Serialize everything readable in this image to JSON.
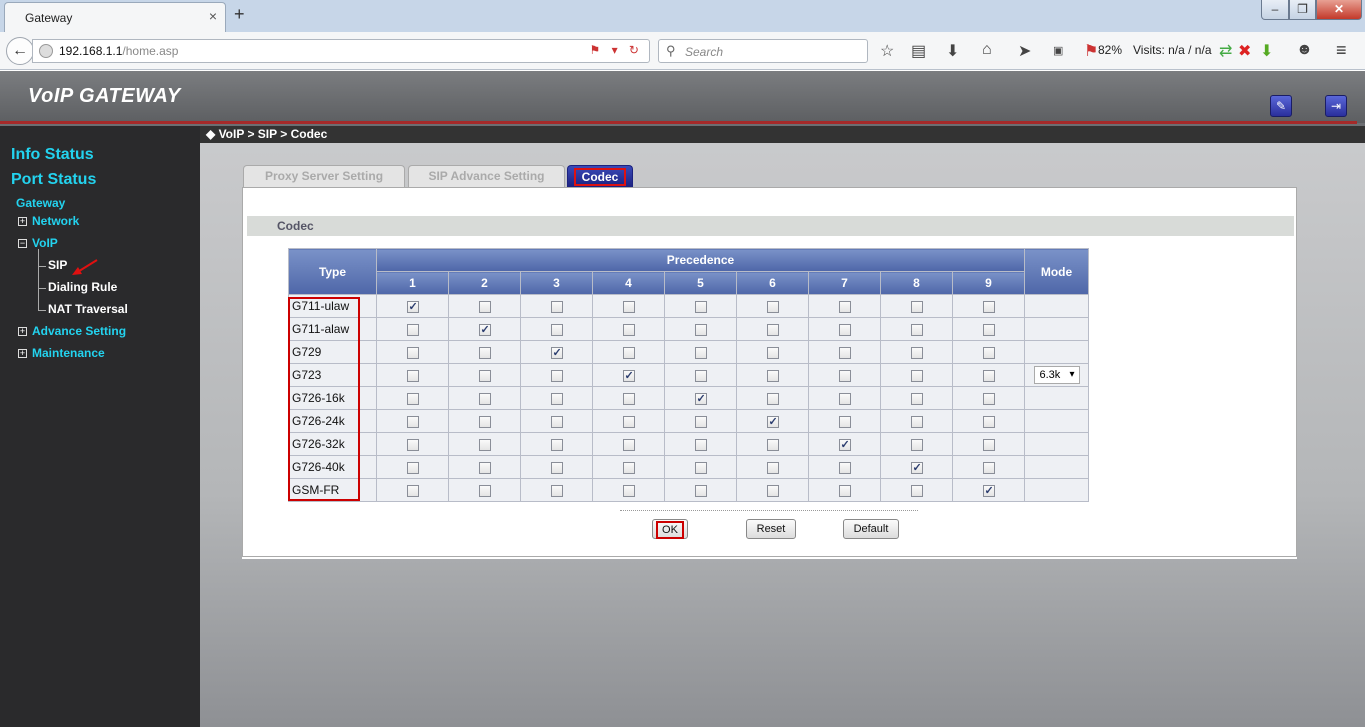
{
  "browser": {
    "tab_title": "Gateway",
    "url_host": "192.168.1.1",
    "url_path": "/home.asp",
    "search_placeholder": "Search",
    "zoom": "82%",
    "visits": "Visits: n/a / n/a"
  },
  "header": {
    "brand": "VoIP GATEWAY"
  },
  "breadcrumb": "◆ VoIP > SIP > Codec",
  "sidebar": {
    "info_status": "Info Status",
    "port_status": "Port Status",
    "gateway": "Gateway",
    "network": "Network",
    "voip": "VoIP",
    "sip": "SIP",
    "dialing_rule": "Dialing Rule",
    "nat_traversal": "NAT Traversal",
    "advance_setting": "Advance Setting",
    "maintenance": "Maintenance"
  },
  "tabs": {
    "proxy": "Proxy Server Setting",
    "sip_advance": "SIP Advance Setting",
    "codec": "Codec"
  },
  "section_title": "Codec",
  "table": {
    "type_header": "Type",
    "precedence_header": "Precedence",
    "mode_header": "Mode",
    "columns": [
      "1",
      "2",
      "3",
      "4",
      "5",
      "6",
      "7",
      "8",
      "9"
    ],
    "rows": [
      {
        "type": "G711-ulaw",
        "checked": 1,
        "mode": ""
      },
      {
        "type": "G711-alaw",
        "checked": 2,
        "mode": ""
      },
      {
        "type": "G729",
        "checked": 3,
        "mode": ""
      },
      {
        "type": "G723",
        "checked": 4,
        "mode": "6.3k"
      },
      {
        "type": "G726-16k",
        "checked": 5,
        "mode": ""
      },
      {
        "type": "G726-24k",
        "checked": 6,
        "mode": ""
      },
      {
        "type": "G726-32k",
        "checked": 7,
        "mode": ""
      },
      {
        "type": "G726-40k",
        "checked": 8,
        "mode": ""
      },
      {
        "type": "GSM-FR",
        "checked": 9,
        "mode": ""
      }
    ]
  },
  "buttons": {
    "ok": "OK",
    "reset": "Reset",
    "default": "Default"
  }
}
